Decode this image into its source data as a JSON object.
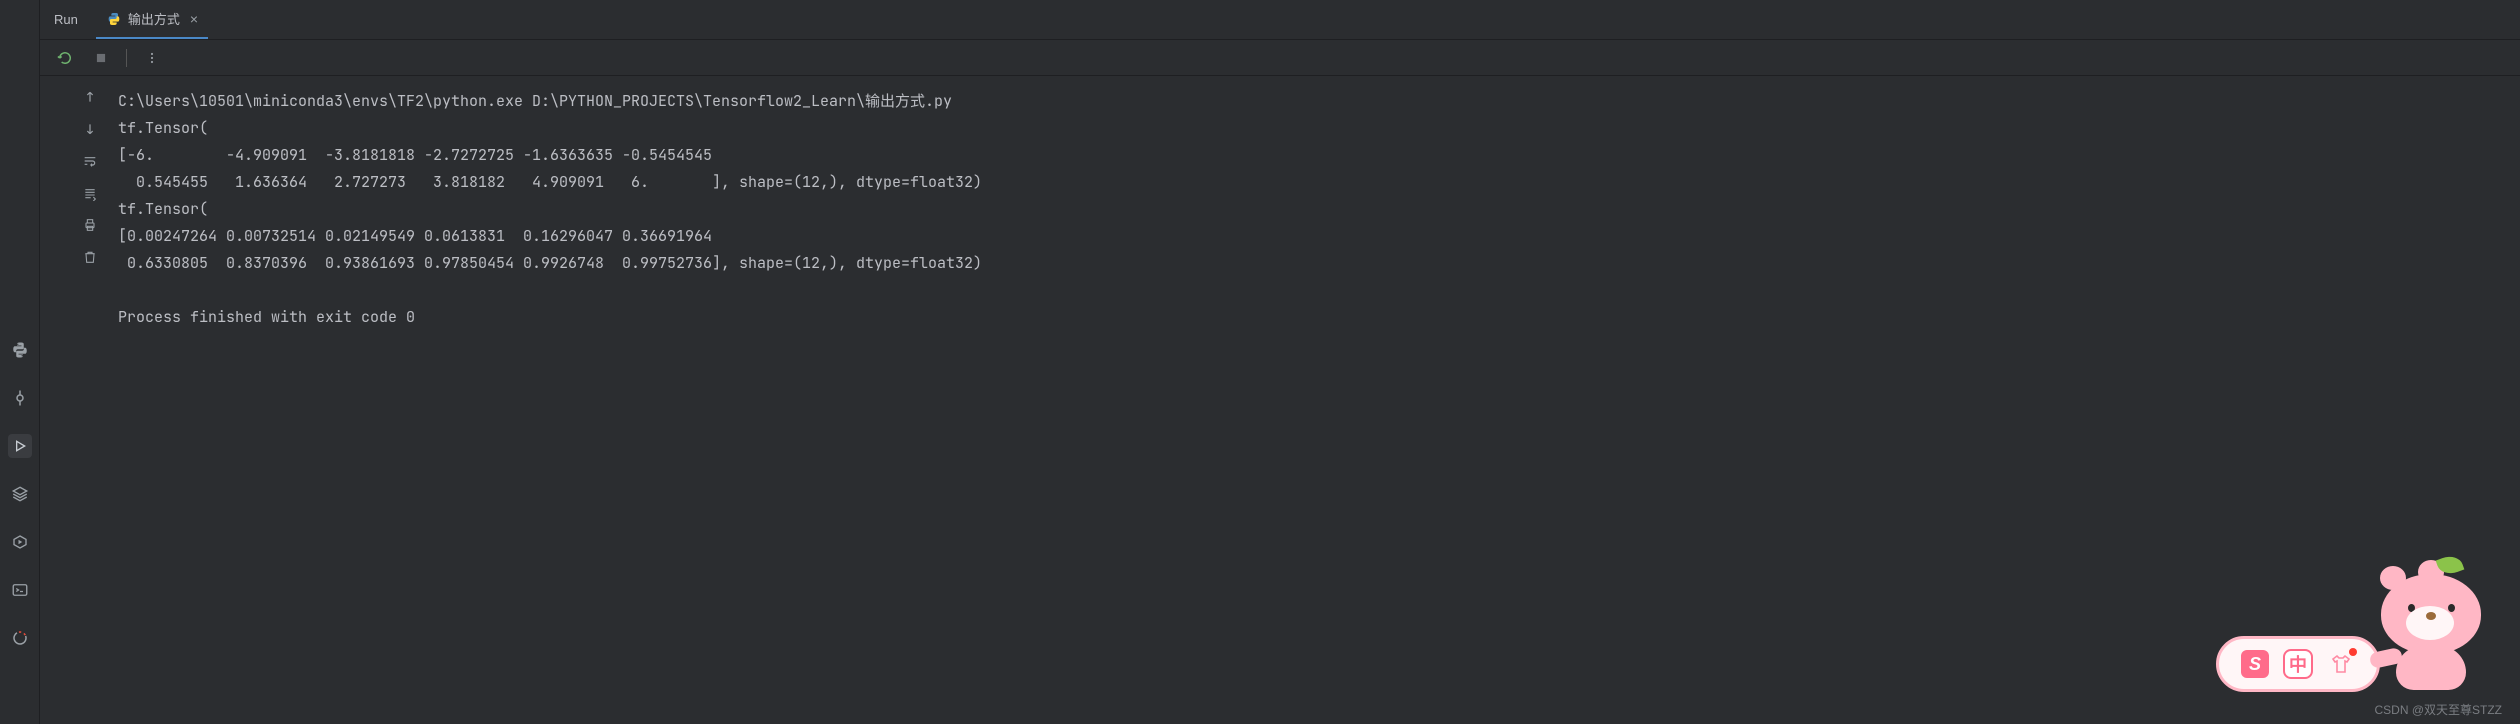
{
  "header": {
    "run_label": "Run",
    "tab": {
      "name": "输出方式",
      "close_glyph": "×"
    }
  },
  "console": {
    "lines": [
      "C:\\Users\\10501\\miniconda3\\envs\\TF2\\python.exe D:\\PYTHON_PROJECTS\\Tensorflow2_Learn\\输出方式.py",
      "tf.Tensor(",
      "[-6.        -4.909091  -3.8181818 -2.7272725 -1.6363635 -0.5454545",
      "  0.545455   1.636364   2.727273   3.818182   4.909091   6.       ], shape=(12,), dtype=float32)",
      "tf.Tensor(",
      "[0.00247264 0.00732514 0.02149549 0.0613831  0.16296047 0.36691964",
      " 0.6330805  0.8370396  0.93861693 0.97850454 0.9926748  0.99752736], shape=(12,), dtype=float32)",
      "",
      "Process finished with exit code 0"
    ]
  },
  "mascot": {
    "badge_s": "S",
    "badge_c": "中"
  },
  "watermark": "CSDN @双天至尊STZZ"
}
